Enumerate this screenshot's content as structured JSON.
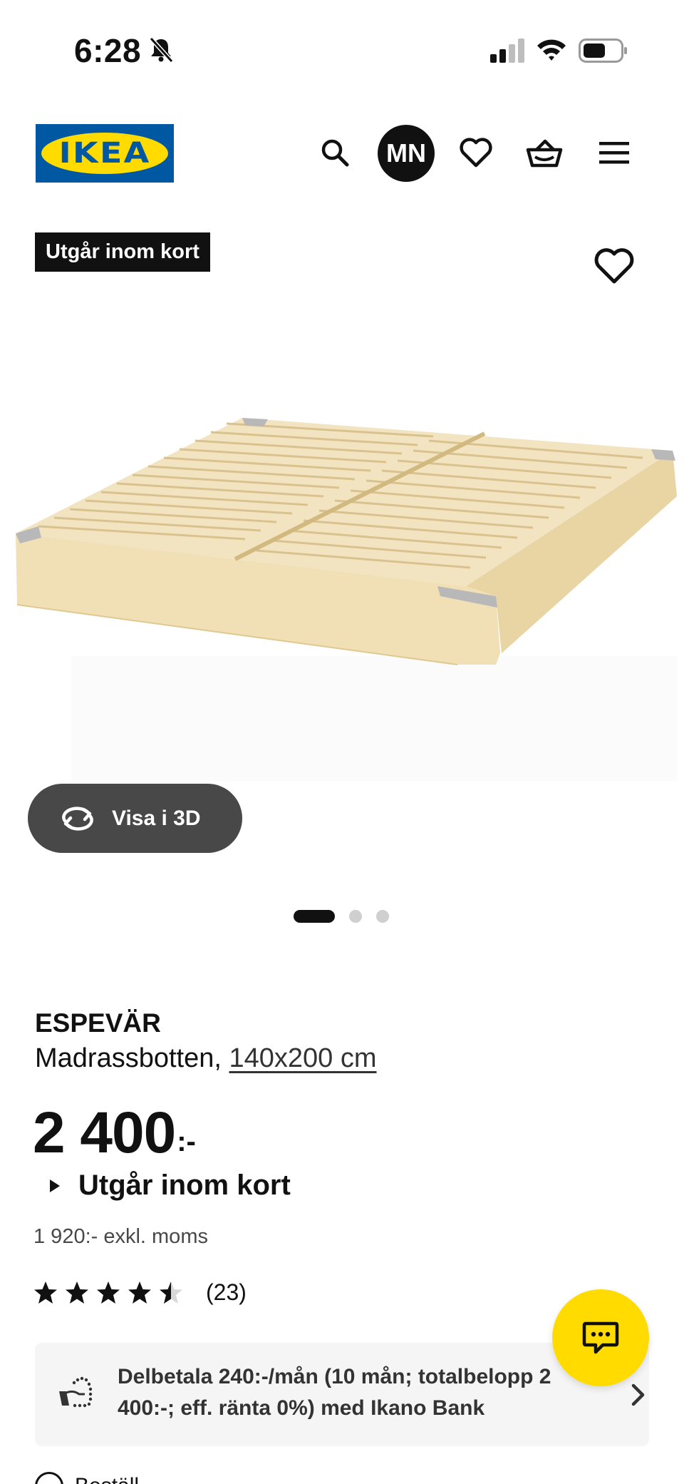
{
  "status_bar": {
    "time": "6:28",
    "icons": [
      "bell-slash-icon",
      "signal-icon",
      "wifi-icon",
      "battery-icon"
    ]
  },
  "header": {
    "logo_text": "IKEA",
    "avatar_initials": "MN",
    "icons": [
      "search-icon",
      "heart-icon",
      "basket-icon",
      "menu-icon"
    ],
    "brand_colors": {
      "blue": "#0058a3",
      "yellow": "#ffdb00"
    }
  },
  "product": {
    "badge": "Utgår inom kort",
    "view_3d_label": "Visa i 3D",
    "carousel": {
      "count": 3,
      "active_index": 0
    },
    "name": "ESPEVÄR",
    "description_prefix": "Madrassbotten,",
    "size_link": "140x200 cm",
    "price": "2 400",
    "price_suffix": ":-",
    "availability": "Utgår inom kort",
    "price_excl_vat": "1 920:- exkl. moms",
    "rating": {
      "value": 4.5,
      "max": 5,
      "count": "(23)"
    }
  },
  "installment": {
    "text": "Delbetala 240:-/mån (10 mån; totalbelopp 2 400:-; eff. ränta 0%) med Ikano Bank"
  },
  "next_row": {
    "label": "Beställ"
  }
}
